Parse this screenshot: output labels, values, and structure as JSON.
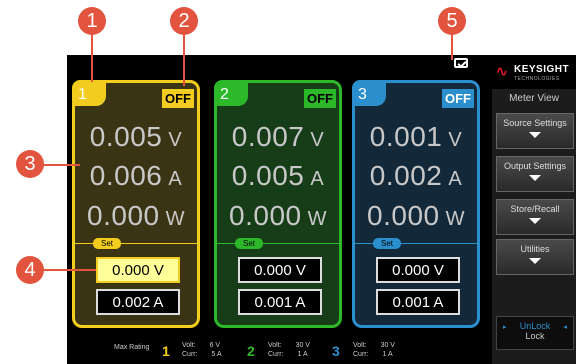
{
  "callouts": [
    "1",
    "2",
    "3",
    "4",
    "5"
  ],
  "channels": [
    {
      "num": "1",
      "state": "OFF",
      "volt": "0.005",
      "volt_unit": "V",
      "amp": "0.006",
      "amp_unit": "A",
      "watt": "0.000",
      "watt_unit": "W",
      "set_label": "Set",
      "set_volt": "0.000 V",
      "set_amp": "0.002 A"
    },
    {
      "num": "2",
      "state": "OFF",
      "volt": "0.007",
      "volt_unit": "V",
      "amp": "0.005",
      "amp_unit": "A",
      "watt": "0.000",
      "watt_unit": "W",
      "set_label": "Set",
      "set_volt": "0.000 V",
      "set_amp": "0.001 A"
    },
    {
      "num": "3",
      "state": "OFF",
      "volt": "0.001",
      "volt_unit": "V",
      "amp": "0.002",
      "amp_unit": "A",
      "watt": "0.000",
      "watt_unit": "W",
      "set_label": "Set",
      "set_volt": "0.000 V",
      "set_amp": "0.001 A"
    }
  ],
  "sidebar": {
    "brand": "KEYSIGHT",
    "brand_sub": "TECHNOLOGIES",
    "view": "Meter View",
    "buttons": [
      "Source Settings",
      "Output Settings",
      "Store/Recall",
      "Utilities"
    ],
    "unlock": "UnLock",
    "lock": "Lock"
  },
  "bottom": {
    "max_rating": "Max Rating",
    "ch": [
      {
        "num": "1",
        "volt_label": "Volt:",
        "volt": "6  V",
        "curr_label": "Curr:",
        "curr": "5  A"
      },
      {
        "num": "2",
        "volt_label": "Volt:",
        "volt": "30  V",
        "curr_label": "Curr:",
        "curr": "1  A"
      },
      {
        "num": "3",
        "volt_label": "Volt:",
        "volt": "30  V",
        "curr_label": "Curr:",
        "curr": "1  A"
      }
    ]
  },
  "colors": {
    "ch1": "#f2cc1f",
    "ch2": "#2db82a",
    "ch3": "#2a8fcc",
    "callout": "#e2543e",
    "brand_red": "#e01a24"
  }
}
